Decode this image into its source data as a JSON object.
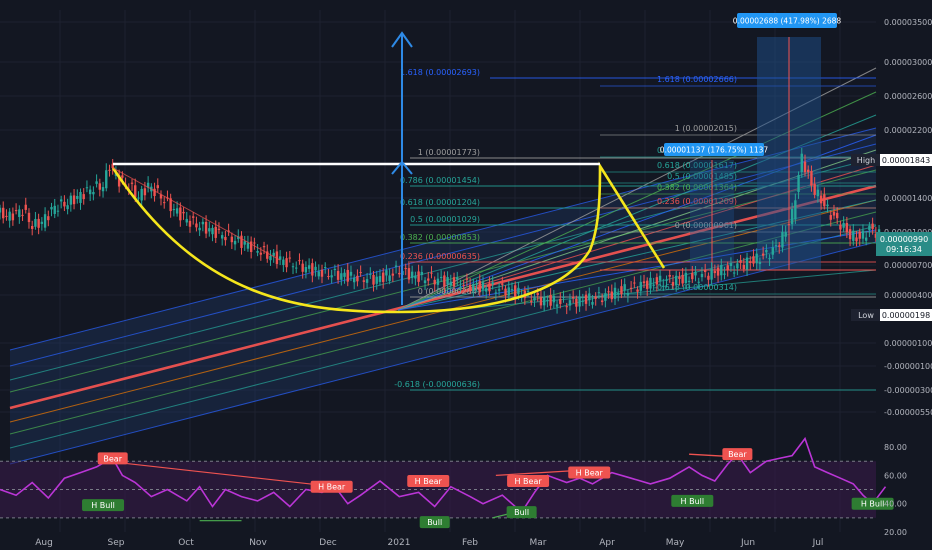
{
  "colors": {
    "background": "#131722",
    "grid": "#1e2230",
    "axis_text": "#b2b5be",
    "candle_up": "#26a69a",
    "candle_down": "#ef5350",
    "cup_handle": "#f5e61c",
    "neckline": "#ffffff",
    "arrow": "#2e8ae6",
    "rsi_line": "#9c27b0",
    "rsi_band": "#3b1a4a",
    "bear_badge": "#ef5350",
    "bull_badge": "#2e7d32",
    "high_label_bg": "#1e2230",
    "price_label_bg": "#2196f3",
    "countdown_bg": "#1e6fb8"
  },
  "price_axis": {
    "ticks": [
      "0.00003500",
      "0.00003000",
      "0.00002600",
      "0.00002200",
      "0.00001400",
      "0.00001000",
      "0.00000700",
      "0.00000400",
      "0.00000100",
      "-0.00000100",
      "-0.00000300",
      "-0.00000550"
    ],
    "tick_values": [
      3.5e-05,
      3e-05,
      2.6e-05,
      2.2e-05,
      1.4e-05,
      1e-05,
      7e-06,
      4e-06,
      1e-06,
      -1e-06,
      -3e-06,
      -5.5e-06
    ],
    "high_label": "High",
    "high_value": "0.00001843",
    "low_label": "Low",
    "low_value": "0.00000198",
    "last_price": "0.00000990",
    "countdown": "09:16:34"
  },
  "time_axis": {
    "labels": [
      "Aug",
      "Sep",
      "Oct",
      "Nov",
      "Dec",
      "2021",
      "Feb",
      "Mar",
      "Apr",
      "May",
      "Jun",
      "Jul"
    ]
  },
  "rsi_axis": {
    "ticks": [
      "80.00",
      "60.00",
      "40.00",
      "20.00"
    ],
    "tick_values": [
      80,
      60,
      40,
      20
    ]
  },
  "fib_left": [
    {
      "label": "1.618 (0.00002693)",
      "price": 2.693e-05
    },
    {
      "label": "1 (0.00001773)",
      "price": 1.773e-05
    },
    {
      "label": "0.786 (0.00001454)",
      "price": 1.454e-05
    },
    {
      "label": "0.618 (0.00001204)",
      "price": 1.204e-05
    },
    {
      "label": "0.5 (0.00001029)",
      "price": 1.029e-05
    },
    {
      "label": "0.382 (0.00000853)",
      "price": 8.53e-06
    },
    {
      "label": "0.236 (0.00000635)",
      "price": 6.35e-06
    },
    {
      "label": "0 (0.00000284)",
      "price": 2.84e-06
    },
    {
      "label": "-0.618 (-0.00000636)",
      "price": -6.36e-06
    }
  ],
  "fib_right": [
    {
      "label": "1.618 (0.00002666)",
      "price": 2.666e-05
    },
    {
      "label": "1 (0.00002015)",
      "price": 2.015e-05
    },
    {
      "label": "0.786 (0.00001790)",
      "price": 1.79e-05
    },
    {
      "label": "0.618 (0.00001617)",
      "price": 1.617e-05
    },
    {
      "label": "0.5 (0.00001485)",
      "price": 1.485e-05
    },
    {
      "label": "0.382 (0.00001364)",
      "price": 1.364e-05
    },
    {
      "label": "0.236 (0.00001209)",
      "price": 1.209e-05
    },
    {
      "label": "0 (0.00000961)",
      "price": 9.61e-06
    },
    {
      "label": "-0.618 (0.00000314)",
      "price": 3.14e-06
    }
  ],
  "measure_labels": {
    "cup_depth": "0.00001137 (176.75%) 1137",
    "target": "0.00002688 (417.98%) 2688"
  },
  "rsi_badges": [
    {
      "text": "Bear",
      "type": "bear",
      "day": 35,
      "rsi": 72
    },
    {
      "text": "H Bull",
      "type": "bull",
      "day": 32,
      "rsi": 39
    },
    {
      "text": "H Bear",
      "type": "bear",
      "day": 103,
      "rsi": 52
    },
    {
      "text": "Bull",
      "type": "bull",
      "day": 135,
      "rsi": 27
    },
    {
      "text": "H Bear",
      "type": "bear",
      "day": 133,
      "rsi": 56
    },
    {
      "text": "H Bear",
      "type": "bear",
      "day": 164,
      "rsi": 56
    },
    {
      "text": "Bull",
      "type": "bull",
      "day": 162,
      "rsi": 34
    },
    {
      "text": "H Bear",
      "type": "bear",
      "day": 183,
      "rsi": 62
    },
    {
      "text": "H Bull",
      "type": "bull",
      "day": 215,
      "rsi": 42
    },
    {
      "text": "Bear",
      "type": "bear",
      "day": 229,
      "rsi": 75
    },
    {
      "text": "H Bull",
      "type": "bull",
      "day": 271,
      "rsi": 40
    }
  ],
  "chart_data": {
    "type": "candlestick",
    "x_start": "2020-07-15",
    "x_unit": "days",
    "price_series": [
      [
        0,
        1.22e-05
      ],
      [
        4,
        1.18e-05
      ],
      [
        8,
        1.25e-05
      ],
      [
        11,
        1.08e-05
      ],
      [
        14,
        1.12e-05
      ],
      [
        18,
        1.28e-05
      ],
      [
        22,
        1.32e-05
      ],
      [
        26,
        1.4e-05
      ],
      [
        30,
        1.48e-05
      ],
      [
        33,
        1.5e-05
      ],
      [
        35,
        1.72e-05
      ],
      [
        38,
        1.55e-05
      ],
      [
        41,
        1.5e-05
      ],
      [
        44,
        1.38e-05
      ],
      [
        47,
        1.5e-05
      ],
      [
        50,
        1.42e-05
      ],
      [
        55,
        1.25e-05
      ],
      [
        60,
        1.12e-05
      ],
      [
        66,
        1.04e-05
      ],
      [
        72,
        9.6e-06
      ],
      [
        78,
        8.8e-06
      ],
      [
        84,
        7.8e-06
      ],
      [
        90,
        7e-06
      ],
      [
        96,
        6.4e-06
      ],
      [
        100,
        6e-06
      ],
      [
        104,
        5.8e-06
      ],
      [
        108,
        5.6e-06
      ],
      [
        112,
        5.4e-06
      ],
      [
        118,
        5.2e-06
      ],
      [
        125,
        6.2e-06
      ],
      [
        130,
        5.5e-06
      ],
      [
        136,
        5.2e-06
      ],
      [
        142,
        4.9e-06
      ],
      [
        148,
        4.5e-06
      ],
      [
        154,
        4.3e-06
      ],
      [
        160,
        4e-06
      ],
      [
        166,
        3.3e-06
      ],
      [
        170,
        3e-06
      ],
      [
        176,
        2.8e-06
      ],
      [
        182,
        3e-06
      ],
      [
        188,
        3.4e-06
      ],
      [
        194,
        4e-06
      ],
      [
        200,
        4.6e-06
      ],
      [
        206,
        5e-06
      ],
      [
        212,
        5.2e-06
      ],
      [
        218,
        5.5e-06
      ],
      [
        224,
        6e-06
      ],
      [
        230,
        6.6e-06
      ],
      [
        236,
        7.3e-06
      ],
      [
        241,
        8.2e-06
      ],
      [
        244,
        9.6e-06
      ],
      [
        247,
        1.2e-05
      ],
      [
        250,
        1.8e-05
      ],
      [
        253,
        1.5e-05
      ],
      [
        256,
        1.35e-05
      ],
      [
        259,
        1.2e-05
      ],
      [
        262,
        1.1e-05
      ],
      [
        265,
        9.8e-06
      ],
      [
        268,
        9.5e-06
      ],
      [
        271,
        1.05e-05
      ],
      [
        274,
        9.9e-06
      ]
    ],
    "rsi_series": [
      [
        0,
        50
      ],
      [
        5,
        46
      ],
      [
        10,
        55
      ],
      [
        15,
        44
      ],
      [
        20,
        58
      ],
      [
        25,
        62
      ],
      [
        30,
        66
      ],
      [
        33,
        70
      ],
      [
        35,
        72
      ],
      [
        38,
        60
      ],
      [
        42,
        55
      ],
      [
        47,
        45
      ],
      [
        52,
        50
      ],
      [
        58,
        42
      ],
      [
        62,
        52
      ],
      [
        66,
        38
      ],
      [
        70,
        50
      ],
      [
        75,
        45
      ],
      [
        80,
        42
      ],
      [
        85,
        48
      ],
      [
        90,
        38
      ],
      [
        95,
        50
      ],
      [
        100,
        48
      ],
      [
        104,
        52
      ],
      [
        108,
        40
      ],
      [
        112,
        46
      ],
      [
        118,
        56
      ],
      [
        124,
        45
      ],
      [
        130,
        48
      ],
      [
        135,
        38
      ],
      [
        140,
        52
      ],
      [
        146,
        45
      ],
      [
        150,
        40
      ],
      [
        156,
        46
      ],
      [
        162,
        34
      ],
      [
        166,
        48
      ],
      [
        170,
        60
      ],
      [
        176,
        55
      ],
      [
        180,
        58
      ],
      [
        184,
        54
      ],
      [
        190,
        62
      ],
      [
        196,
        58
      ],
      [
        202,
        54
      ],
      [
        208,
        58
      ],
      [
        214,
        66
      ],
      [
        218,
        60
      ],
      [
        222,
        56
      ],
      [
        226,
        68
      ],
      [
        229,
        75
      ],
      [
        233,
        62
      ],
      [
        238,
        70
      ],
      [
        242,
        72
      ],
      [
        246,
        74
      ],
      [
        250,
        86
      ],
      [
        253,
        66
      ],
      [
        257,
        62
      ],
      [
        261,
        58
      ],
      [
        265,
        54
      ],
      [
        268,
        46
      ],
      [
        271,
        40
      ],
      [
        275,
        52
      ]
    ],
    "high": 1.843e-05,
    "low": 1.98e-06,
    "last": 9.9e-06,
    "rsi_levels": [
      70,
      50,
      30
    ]
  }
}
